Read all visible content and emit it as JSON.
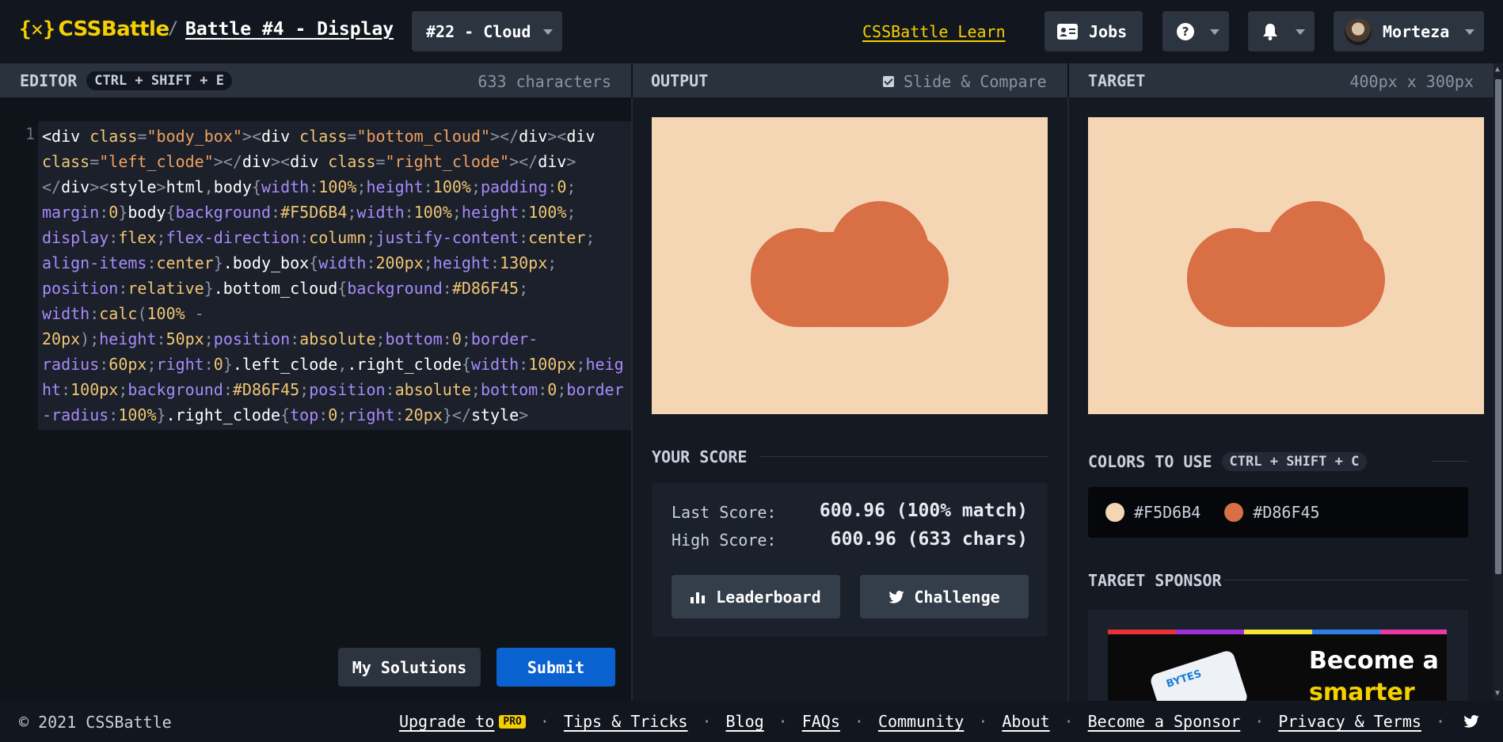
{
  "header": {
    "logo_mark": "{✕}",
    "logo_text": "CSSBattle",
    "crumb_sep": "/",
    "battle_title": "Battle #4 - Display",
    "target_select": "#22 - Cloud",
    "learn_link": "CSSBattle Learn",
    "jobs_label": "Jobs",
    "user_name": "Morteza"
  },
  "editor": {
    "title": "EDITOR",
    "shortcut": "CTRL + SHIFT + E",
    "char_count": "633 characters",
    "line_number": "1",
    "my_solutions_label": "My Solutions",
    "submit_label": "Submit"
  },
  "output": {
    "title": "OUTPUT",
    "compare_label": "Slide & Compare",
    "score_title": "YOUR SCORE",
    "last_score_label": "Last Score:",
    "last_score_value": "600.96 (100% match)",
    "high_score_label": "High Score:",
    "high_score_value": "600.96 (633 chars)",
    "leaderboard_label": "Leaderboard",
    "challenge_label": "Challenge"
  },
  "target": {
    "title": "TARGET",
    "size": "400px x 300px",
    "colors_title": "COLORS TO USE",
    "colors_shortcut": "CTRL + SHIFT + C",
    "colors": [
      {
        "hex": "#F5D6B4"
      },
      {
        "hex": "#D86F45"
      }
    ],
    "sponsor_title": "TARGET SPONSOR",
    "sponsor_line1": "Become a",
    "sponsor_line2": "smarter",
    "sponsor_phone_text": "BYTES"
  },
  "footer": {
    "copyright": "© 2021 CSSBattle",
    "upgrade": "Upgrade to",
    "pro_badge": "PRO",
    "tips": "Tips & Tricks",
    "blog": "Blog",
    "faqs": "FAQs",
    "community": "Community",
    "about": "About",
    "sponsor": "Become a Sponsor",
    "privacy": "Privacy & Terms",
    "dot": "·"
  },
  "colors": {
    "background": "#F5D6B4",
    "cloud": "#D86F45",
    "accent": "#f5d000",
    "submit": "#0a62d0"
  }
}
